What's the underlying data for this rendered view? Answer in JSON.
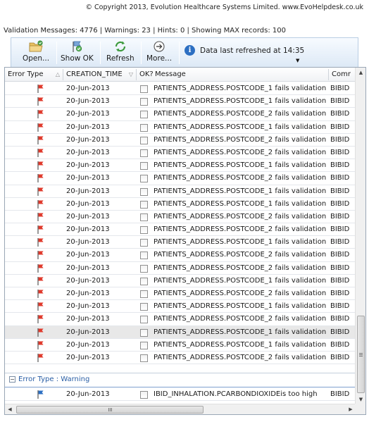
{
  "copyright": "© Copyright 2013, Evolution Healthcare Systems Limited. www.EvoHelpdesk.co.uk",
  "summary": "Validation Messages: 4776 | Warnings: 23 | Hints: 0 | Showing MAX records: 100",
  "toolbar": {
    "open_label": "Open...",
    "show_ok_label": "Show OK",
    "refresh_label": "Refresh",
    "more_label": "More...",
    "info_text": "Data last refreshed at 14:35"
  },
  "columns": {
    "error_type": "Error Type",
    "creation_time": "CREATION_TIME",
    "ok": "OK?",
    "message": "Message",
    "comment": "Comr"
  },
  "rows": [
    {
      "date": "20-Jun-2013",
      "message": "PATIENTS_ADDRESS.POSTCODE_1 fails validation",
      "comment": "BIBID"
    },
    {
      "date": "20-Jun-2013",
      "message": "PATIENTS_ADDRESS.POSTCODE_1 fails validation",
      "comment": "BIBID"
    },
    {
      "date": "20-Jun-2013",
      "message": "PATIENTS_ADDRESS.POSTCODE_2 fails validation",
      "comment": "BIBID"
    },
    {
      "date": "20-Jun-2013",
      "message": "PATIENTS_ADDRESS.POSTCODE_1 fails validation",
      "comment": "BIBID"
    },
    {
      "date": "20-Jun-2013",
      "message": "PATIENTS_ADDRESS.POSTCODE_2 fails validation",
      "comment": "BIBID"
    },
    {
      "date": "20-Jun-2013",
      "message": "PATIENTS_ADDRESS.POSTCODE_2 fails validation",
      "comment": "BIBID"
    },
    {
      "date": "20-Jun-2013",
      "message": "PATIENTS_ADDRESS.POSTCODE_1 fails validation",
      "comment": "BIBID"
    },
    {
      "date": "20-Jun-2013",
      "message": "PATIENTS_ADDRESS.POSTCODE_2 fails validation",
      "comment": "BIBID"
    },
    {
      "date": "20-Jun-2013",
      "message": "PATIENTS_ADDRESS.POSTCODE_1 fails validation",
      "comment": "BIBID"
    },
    {
      "date": "20-Jun-2013",
      "message": "PATIENTS_ADDRESS.POSTCODE_1 fails validation",
      "comment": "BIBID"
    },
    {
      "date": "20-Jun-2013",
      "message": "PATIENTS_ADDRESS.POSTCODE_2 fails validation",
      "comment": "BIBID"
    },
    {
      "date": "20-Jun-2013",
      "message": "PATIENTS_ADDRESS.POSTCODE_2 fails validation",
      "comment": "BIBID"
    },
    {
      "date": "20-Jun-2013",
      "message": "PATIENTS_ADDRESS.POSTCODE_1 fails validation",
      "comment": "BIBID"
    },
    {
      "date": "20-Jun-2013",
      "message": "PATIENTS_ADDRESS.POSTCODE_2 fails validation",
      "comment": "BIBID"
    },
    {
      "date": "20-Jun-2013",
      "message": "PATIENTS_ADDRESS.POSTCODE_2 fails validation",
      "comment": "BIBID"
    },
    {
      "date": "20-Jun-2013",
      "message": "PATIENTS_ADDRESS.POSTCODE_1 fails validation",
      "comment": "BIBID"
    },
    {
      "date": "20-Jun-2013",
      "message": "PATIENTS_ADDRESS.POSTCODE_2 fails validation",
      "comment": "BIBID"
    },
    {
      "date": "20-Jun-2013",
      "message": "PATIENTS_ADDRESS.POSTCODE_1 fails validation",
      "comment": "BIBID"
    },
    {
      "date": "20-Jun-2013",
      "message": "PATIENTS_ADDRESS.POSTCODE_2 fails validation",
      "comment": "BIBID"
    },
    {
      "date": "20-Jun-2013",
      "message": "PATIENTS_ADDRESS.POSTCODE_1 fails validation",
      "comment": "BIBID",
      "selected": true
    },
    {
      "date": "20-Jun-2013",
      "message": "PATIENTS_ADDRESS.POSTCODE_1 fails validation",
      "comment": "BIBID"
    },
    {
      "date": "20-Jun-2013",
      "message": "PATIENTS_ADDRESS.POSTCODE_2 fails validation",
      "comment": "BIBID"
    }
  ],
  "group": {
    "label": "Error Type : Warning",
    "collapse_symbol": "−"
  },
  "warning_row": {
    "date": "20-Jun-2013",
    "message": "IBID_INHALATION.PCARBONDIOXIDEis too high",
    "comment": "BIBID"
  },
  "colors": {
    "error_flag": "#e0392b",
    "warning_flag": "#2c6fc2",
    "group_text": "#2b5fa5"
  },
  "icons": {
    "open": "folder-open-icon",
    "show_ok": "flag-check-icon",
    "refresh": "refresh-icon",
    "more": "circle-arrow-icon",
    "info": "info-icon"
  }
}
